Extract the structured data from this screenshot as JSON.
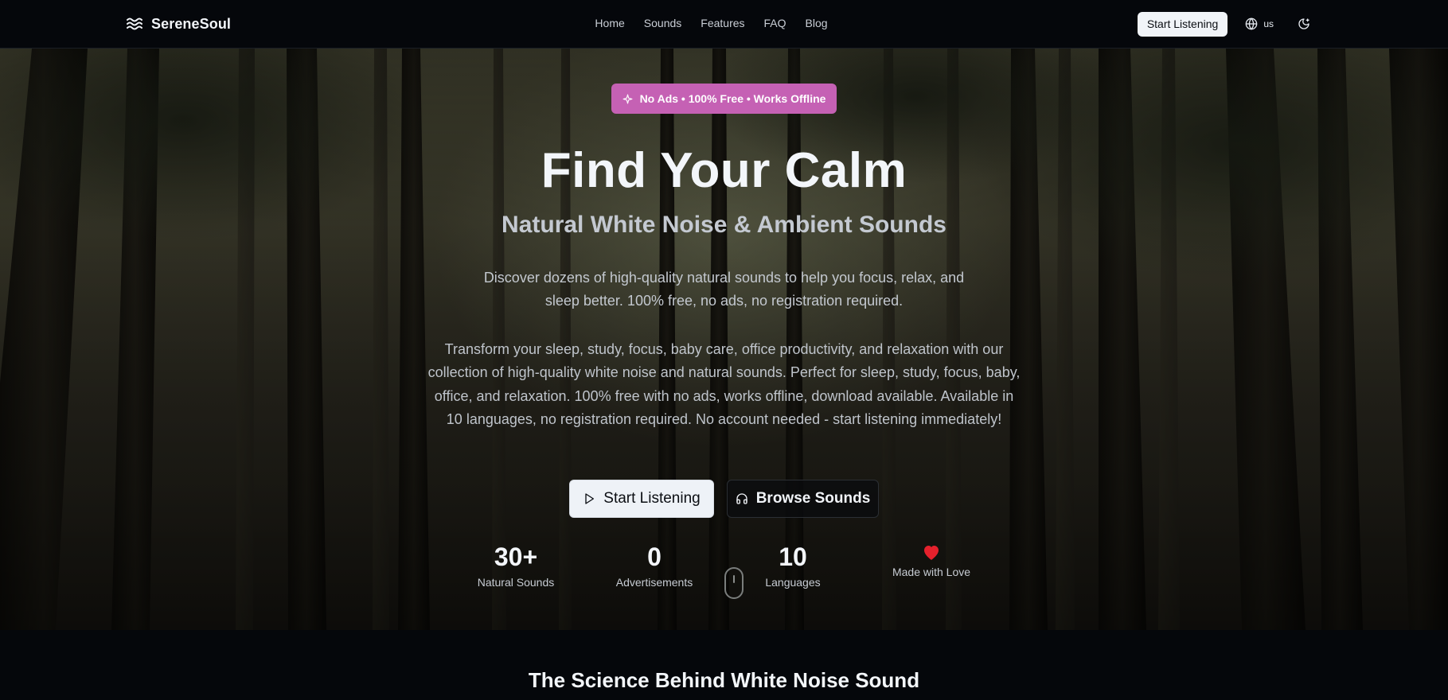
{
  "nav": {
    "brand": "SereneSoul",
    "links": [
      "Home",
      "Sounds",
      "Features",
      "FAQ",
      "Blog"
    ],
    "cta": "Start Listening",
    "language": "us",
    "icons": {
      "logo": "waves-icon",
      "language": "globe-icon",
      "theme": "moon-icon"
    }
  },
  "hero": {
    "badge": "No Ads • 100% Free • Works Offline",
    "title": "Find Your Calm",
    "subtitle": "Natural White Noise & Ambient Sounds",
    "description": "Discover dozens of high-quality natural sounds to help you focus, relax, and sleep better. 100% free, no ads, no registration required.",
    "long_description": "Transform your sleep, study, focus, baby care, office productivity, and relaxation with our collection of high-quality white noise and natural sounds. Perfect for sleep, study, focus, baby, office, and relaxation. 100% free with no ads, works offline, download available. Available in 10 languages, no registration required. No account needed - start listening immediately!",
    "primary_button": "Start Listening",
    "secondary_button": "Browse Sounds",
    "stats": [
      {
        "value": "30+",
        "label": "Natural Sounds"
      },
      {
        "value": "0",
        "label": "Advertisements"
      },
      {
        "value": "10",
        "label": "Languages"
      },
      {
        "label": "Made with Love"
      }
    ]
  },
  "science": {
    "heading": "The Science Behind White Noise Sound"
  },
  "colors": {
    "background": "#05070b",
    "badge": "#c561b4",
    "heart": "#e5212c",
    "button_light": "#eef2f7"
  }
}
